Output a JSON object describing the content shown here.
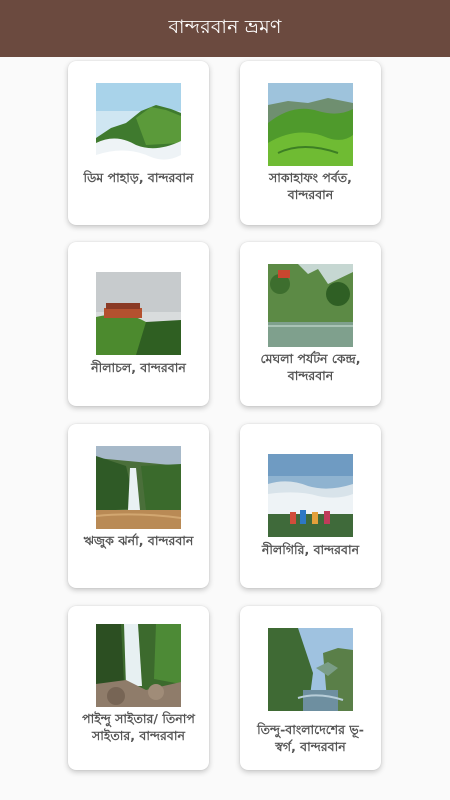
{
  "app": {
    "title": "বান্দরবান ভ্রমণ",
    "colors": {
      "appbar": "#6b4a3f",
      "background": "#fafafa",
      "caption": "#555555"
    }
  },
  "places": [
    {
      "name": "ডিম পাহাড়, বান্দরবান",
      "image": "misty-green-mountain"
    },
    {
      "name": "সাকাহাফং পর্বত, বান্দরবান",
      "image": "green-hills"
    },
    {
      "name": "নীলাচল, বান্দরবান",
      "image": "hilltop-resort-clouds"
    },
    {
      "name": "মেঘলা পর্যটন কেন্দ্র, বান্দরবান",
      "image": "lake-forest"
    },
    {
      "name": "ঋজুক ঝর্না, বান্দরবান",
      "image": "waterfall-river"
    },
    {
      "name": "নীলগিরি, বান্দরবান",
      "image": "cloud-sea-viewpoint"
    },
    {
      "name": "পাইন্দু সাইতার/ তিনাপ সাইতার, বান্দরবান",
      "image": "waterfall-rocks"
    },
    {
      "name": "তিন্দু-বাংলাদেশের ভূ-স্বর্গ, বান্দরবান",
      "image": "river-gorge"
    }
  ]
}
